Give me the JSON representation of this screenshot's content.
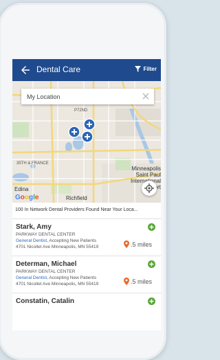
{
  "header": {
    "title": "Dental Care",
    "filter_label": "Filter"
  },
  "colors": {
    "appbar": "#1f4a8d",
    "accent": "#2b65b7",
    "add": "#5aa63a",
    "pin": "#e86a2b"
  },
  "map": {
    "search_value": "My Location",
    "labels": {
      "p": "P72ND",
      "france": "35TH & FRANCE",
      "minneapolis": "Minneapolis",
      "stpaul": "Saint Paul",
      "intl": "International",
      "airport": "Airport",
      "edina": "Edina",
      "richfield": "Richfield"
    },
    "attribution": {
      "g1": "G",
      "g2": "o",
      "g3": "o",
      "g4": "g",
      "g5": "l",
      "g6": "e"
    }
  },
  "results_text": "100 In Network Dental Providers Found Near Your Loca...",
  "providers": [
    {
      "name": "Stark, Amy",
      "center": "PARKWAY DENTAL CENTER",
      "specialty": "General Dentist",
      "accepting": ", Accepting New Patients",
      "address": "4701 Nicollet Ave Minneapolis, MN 55419",
      "distance": ".5 miles"
    },
    {
      "name": "Determan, Michael",
      "center": "PARKWAY DENTAL CENTER",
      "specialty": "General Dentist",
      "accepting": ", Accepting New Patients",
      "address": "4701 Nicollet Ave Minneapolis, MN 55419",
      "distance": ".5 miles"
    },
    {
      "name": "Constatin, Catalin"
    }
  ]
}
